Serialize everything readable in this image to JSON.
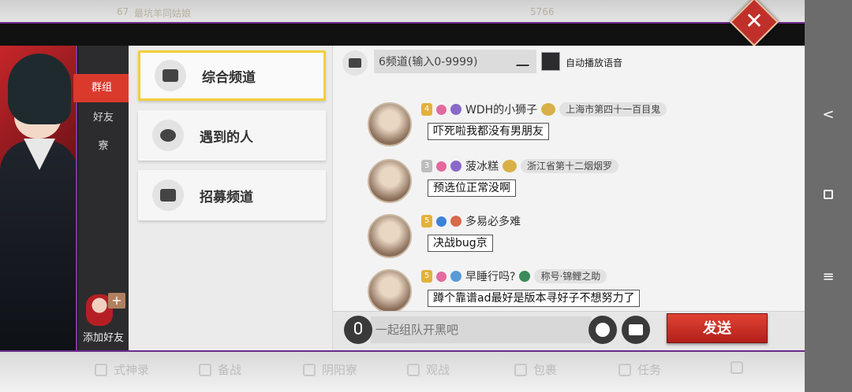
{
  "background": {
    "top_level": "67",
    "top_name": "最坑羊同姑娘",
    "top_coins": "5766",
    "bottom_nav": [
      "式神录",
      "备战",
      "阴阳寮",
      "观战",
      "包裹",
      "任务"
    ]
  },
  "side_tabs": [
    "群组",
    "好友",
    "寮"
  ],
  "add_friend_label": "添加好友",
  "channels": [
    {
      "label": "综合频道",
      "active": true
    },
    {
      "label": "遇到的人",
      "active": false
    },
    {
      "label": "招募频道",
      "active": false
    }
  ],
  "chat": {
    "channel_input_value": "6频道(输入0-9999)",
    "autoplay_label": "自动播放语音",
    "messages": [
      {
        "level": "4",
        "name": "WDH的小狮子",
        "region": "上海市第四十一百目鬼",
        "text": "吓死啦我都没有男朋友"
      },
      {
        "level": "3",
        "name": "菠冰糕",
        "region": "浙江省第十二烟烟罗",
        "text": "预选位正常没啊"
      },
      {
        "level": "5",
        "name": "多易必多难",
        "region": "",
        "text": "决战bug京"
      },
      {
        "level": "5",
        "name": "早睡行吗?",
        "region": "称号·锦鲤之助",
        "text": "蹲个靠谱ad最好是版本寻好子不想努力了"
      }
    ],
    "input_placeholder": "一起组队开黑吧",
    "send_label": "发送"
  },
  "nav": {
    "back": "<",
    "menu": "≡"
  }
}
